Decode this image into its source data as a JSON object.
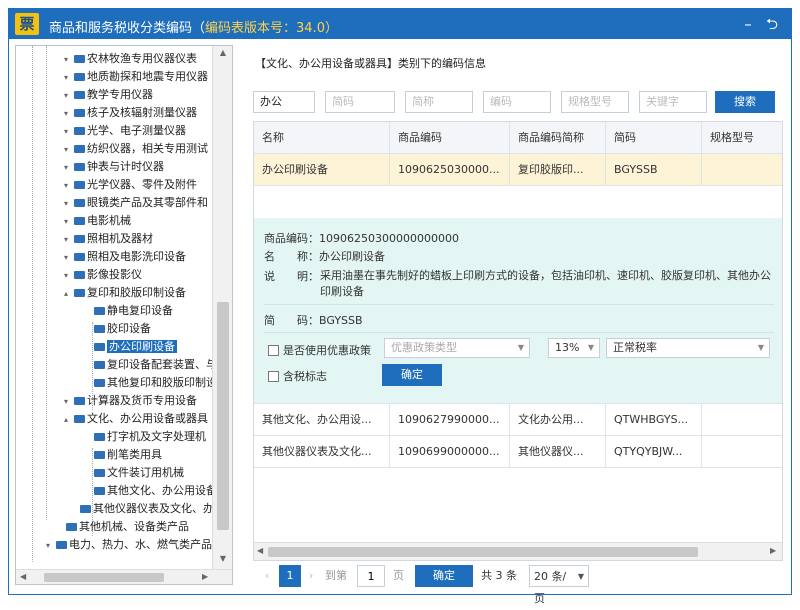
{
  "window": {
    "title": "商品和服务税收分类编码（",
    "version": "编码表版本号：34.0",
    "title_close": "）",
    "icon_glyph": "票",
    "minimize_glyph": "–",
    "back_glyph": "⮌"
  },
  "tree": {
    "items": [
      {
        "label": "农林牧渔专用仪器仪表"
      },
      {
        "label": "地质勘探和地震专用仪器"
      },
      {
        "label": "教学专用仪器"
      },
      {
        "label": "核子及核辐射测量仪器"
      },
      {
        "label": "光学、电子测量仪器"
      },
      {
        "label": "纺织仪器，相关专用测试"
      },
      {
        "label": "钟表与计时仪器"
      },
      {
        "label": "光学仪器、零件及附件"
      },
      {
        "label": "眼镜类产品及其零部件和"
      },
      {
        "label": "电影机械"
      },
      {
        "label": "照相机及器材"
      },
      {
        "label": "照相及电影洗印设备"
      },
      {
        "label": "影像投影仪"
      },
      {
        "label": "复印和胶版印制设备"
      },
      {
        "label": "静电复印设备"
      },
      {
        "label": "胶印设备"
      },
      {
        "label": "办公印刷设备"
      },
      {
        "label": "复印设备配套装置、与"
      },
      {
        "label": "其他复印和胶版印制设"
      },
      {
        "label": "计算器及货币专用设备"
      },
      {
        "label": "文化、办公用设备或器具"
      },
      {
        "label": "打字机及文字处理机"
      },
      {
        "label": "削笔类用具"
      },
      {
        "label": "文件装订用机械"
      },
      {
        "label": "其他文化、办公用设备"
      },
      {
        "label": "其他仪器仪表及文化、办"
      },
      {
        "label": "其他机械、设备类产品"
      },
      {
        "label": "电力、热力、水、燃气类产品"
      }
    ]
  },
  "category_title": "【文化、办公用设备或器具】类别下的编码信息",
  "search": {
    "name_value": "办公",
    "short_code": "简码",
    "short_name": "简称",
    "code": "编码",
    "spec": "规格型号",
    "keyword": "关键字",
    "button": "搜索"
  },
  "grid": {
    "columns": [
      "名称",
      "商品编码",
      "商品编码简称",
      "简码",
      "规格型号"
    ],
    "rows": [
      {
        "name": "办公印刷设备",
        "code": "1090625030000...",
        "short": "复印胶版印...",
        "abbr": "BGYSSB",
        "spec": ""
      },
      {
        "name": "其他文化、办公用设...",
        "code": "1090627990000...",
        "short": "文化办公用...",
        "abbr": "QTWHBGYS...",
        "spec": ""
      },
      {
        "name": "其他仪器仪表及文化...",
        "code": "1090699000000...",
        "short": "其他仪器仪...",
        "abbr": "QTYQYBJW...",
        "spec": ""
      }
    ]
  },
  "detail": {
    "code_line": "商品编码：10906250300000000000",
    "name_line": "名　　称：办公印刷设备",
    "desc_label": "说　　明：",
    "desc_text": "采用油墨在事先制好的蜡板上印刷方式的设备，包括油印机、速印机、胶版复印机、其他办公印刷设备",
    "abbr_line": "简　　码：BGYSSB",
    "policy_check": "是否使用优惠政策",
    "policy_type": "优惠政策类型",
    "rate": "13%",
    "rate_type": "正常税率",
    "tax_flag": "含税标志",
    "ok": "确定"
  },
  "pager": {
    "page": "1",
    "goto_label": "到第",
    "goto_value": "1",
    "page_unit": "页",
    "confirm": "确定",
    "total": "共 3 条",
    "per_page": "20 条/页"
  }
}
